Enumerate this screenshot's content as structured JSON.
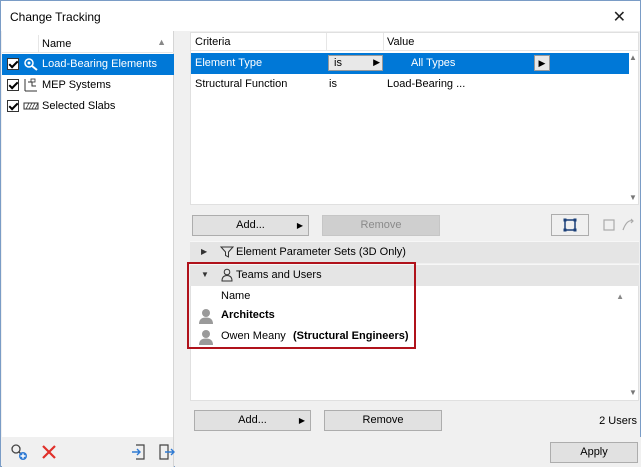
{
  "window": {
    "title": "Change Tracking"
  },
  "left": {
    "header": "Name",
    "items": [
      {
        "label": "Load-Bearing Elements",
        "checked": true,
        "icon": "magnifier-icon",
        "selected": true
      },
      {
        "label": "MEP Systems",
        "checked": true,
        "icon": "mep-icon",
        "selected": false
      },
      {
        "label": "Selected Slabs",
        "checked": true,
        "icon": "slab-icon",
        "selected": false
      }
    ]
  },
  "criteria": {
    "headers": {
      "criteria": "Criteria",
      "value": "Value"
    },
    "rows": [
      {
        "criteria": "Element Type",
        "op": "is",
        "value": "All Types",
        "selected": true
      },
      {
        "criteria": "Structural Function",
        "op": "is",
        "value": "Load-Bearing ...",
        "selected": false
      }
    ],
    "add_label": "Add...",
    "remove_label": "Remove"
  },
  "sections": {
    "param_sets": "Element Parameter Sets (3D Only)",
    "teams": "Teams and Users"
  },
  "users": {
    "header": "Name",
    "rows": [
      {
        "name": "Architects",
        "team": ""
      },
      {
        "name": "Owen Meany",
        "team": "(Structural Engineers)"
      }
    ],
    "add_label": "Add...",
    "remove_label": "Remove",
    "count": "2 Users"
  },
  "footer": {
    "apply_label": "Apply"
  },
  "colors": {
    "accent": "#0078d7",
    "highlight": "#b0121b"
  }
}
